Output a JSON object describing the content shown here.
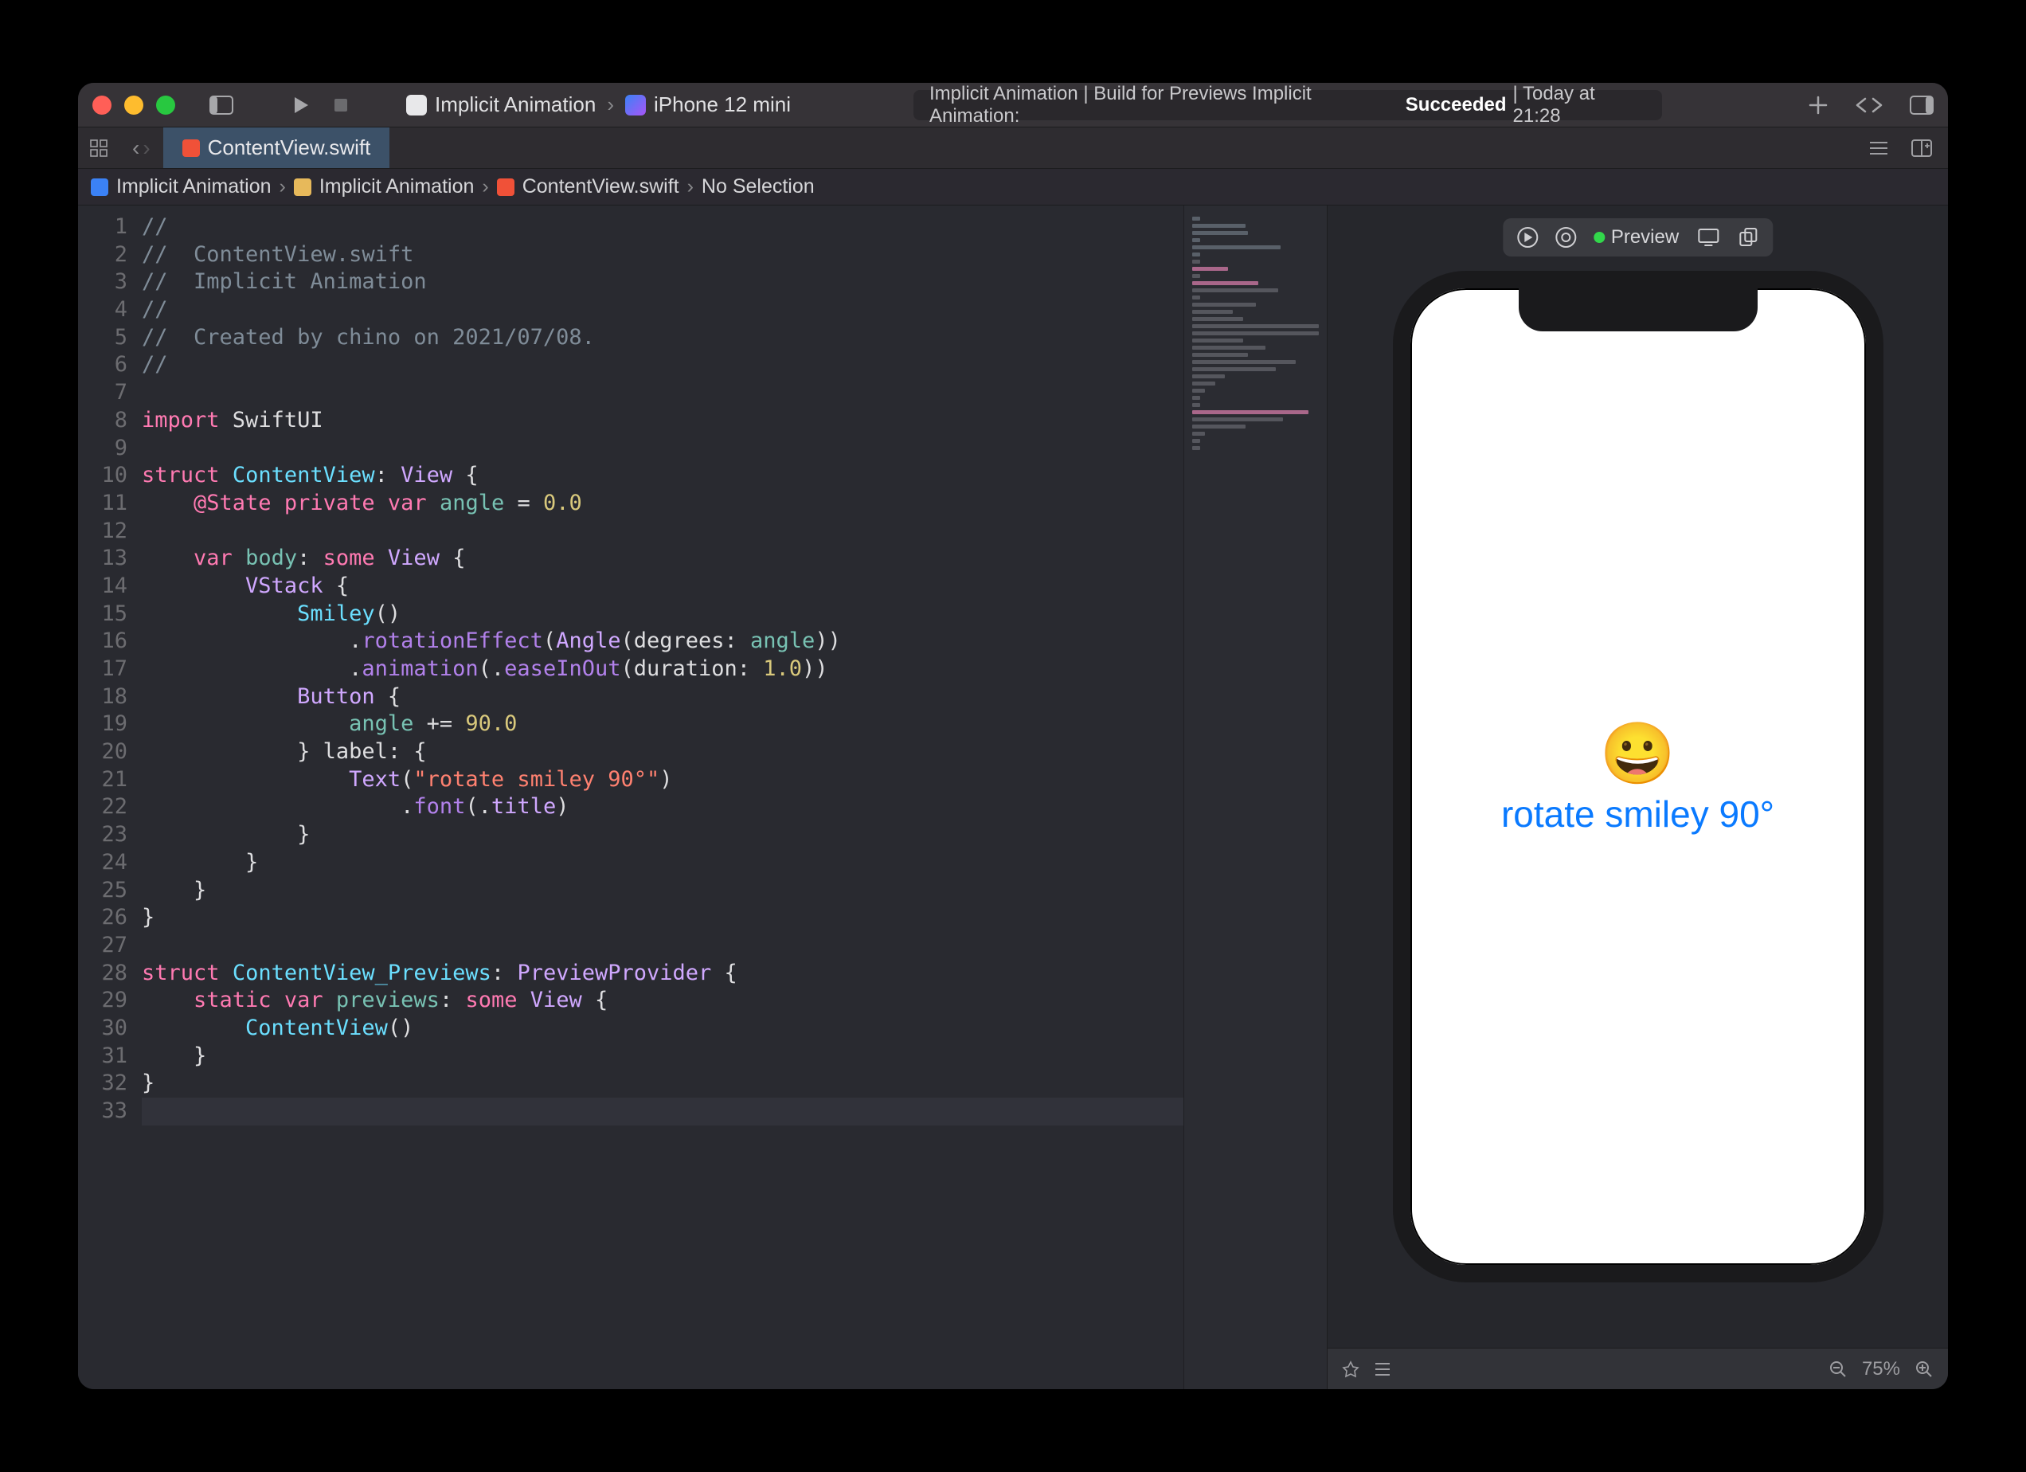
{
  "toolbar": {
    "scheme_project": "Implicit Animation",
    "scheme_device": "iPhone 12 mini"
  },
  "status": {
    "prefix": "Implicit Animation | Build for Previews Implicit Animation: ",
    "result": "Succeeded",
    "suffix": " | Today at 21:28"
  },
  "tab": {
    "filename": "ContentView.swift"
  },
  "jumpbar": {
    "project": "Implicit Animation",
    "group": "Implicit Animation",
    "file": "ContentView.swift",
    "selection": "No Selection"
  },
  "code": {
    "lines": [
      {
        "n": 1,
        "seg": [
          {
            "c": "cmt",
            "t": "//"
          }
        ]
      },
      {
        "n": 2,
        "seg": [
          {
            "c": "cmt",
            "t": "//  ContentView.swift"
          }
        ]
      },
      {
        "n": 3,
        "seg": [
          {
            "c": "cmt",
            "t": "//  Implicit Animation"
          }
        ]
      },
      {
        "n": 4,
        "seg": [
          {
            "c": "cmt",
            "t": "//"
          }
        ]
      },
      {
        "n": 5,
        "seg": [
          {
            "c": "cmt",
            "t": "//  Created by chino on 2021/07/08."
          }
        ]
      },
      {
        "n": 6,
        "seg": [
          {
            "c": "cmt",
            "t": "//"
          }
        ]
      },
      {
        "n": 7,
        "seg": []
      },
      {
        "n": 8,
        "seg": [
          {
            "c": "kw-pink",
            "t": "import"
          },
          {
            "c": "plain",
            "t": " SwiftUI"
          }
        ]
      },
      {
        "n": 9,
        "seg": []
      },
      {
        "n": 10,
        "seg": [
          {
            "c": "kw-pink",
            "t": "struct"
          },
          {
            "c": "plain",
            "t": " "
          },
          {
            "c": "type",
            "t": "ContentView"
          },
          {
            "c": "plain",
            "t": ": "
          },
          {
            "c": "type2",
            "t": "View"
          },
          {
            "c": "plain",
            "t": " {"
          }
        ]
      },
      {
        "n": 11,
        "seg": [
          {
            "c": "plain",
            "t": "    "
          },
          {
            "c": "kw-pink",
            "t": "@State"
          },
          {
            "c": "plain",
            "t": " "
          },
          {
            "c": "kw-pink",
            "t": "private"
          },
          {
            "c": "plain",
            "t": " "
          },
          {
            "c": "kw-pink",
            "t": "var"
          },
          {
            "c": "plain",
            "t": " "
          },
          {
            "c": "ident",
            "t": "angle"
          },
          {
            "c": "plain",
            "t": " = "
          },
          {
            "c": "num",
            "t": "0.0"
          }
        ]
      },
      {
        "n": 12,
        "seg": []
      },
      {
        "n": 13,
        "seg": [
          {
            "c": "plain",
            "t": "    "
          },
          {
            "c": "kw-pink",
            "t": "var"
          },
          {
            "c": "plain",
            "t": " "
          },
          {
            "c": "ident",
            "t": "body"
          },
          {
            "c": "plain",
            "t": ": "
          },
          {
            "c": "kw-pink",
            "t": "some"
          },
          {
            "c": "plain",
            "t": " "
          },
          {
            "c": "type2",
            "t": "View"
          },
          {
            "c": "plain",
            "t": " {"
          }
        ]
      },
      {
        "n": 14,
        "seg": [
          {
            "c": "plain",
            "t": "        "
          },
          {
            "c": "type2",
            "t": "VStack"
          },
          {
            "c": "plain",
            "t": " {"
          }
        ]
      },
      {
        "n": 15,
        "seg": [
          {
            "c": "plain",
            "t": "            "
          },
          {
            "c": "type",
            "t": "Smiley"
          },
          {
            "c": "plain",
            "t": "()"
          }
        ]
      },
      {
        "n": 16,
        "seg": [
          {
            "c": "plain",
            "t": "                ."
          },
          {
            "c": "method",
            "t": "rotationEffect"
          },
          {
            "c": "plain",
            "t": "("
          },
          {
            "c": "type2",
            "t": "Angle"
          },
          {
            "c": "plain",
            "t": "(degrees: "
          },
          {
            "c": "ident",
            "t": "angle"
          },
          {
            "c": "plain",
            "t": "))"
          }
        ]
      },
      {
        "n": 17,
        "seg": [
          {
            "c": "plain",
            "t": "                ."
          },
          {
            "c": "method",
            "t": "animation"
          },
          {
            "c": "plain",
            "t": "(."
          },
          {
            "c": "method",
            "t": "easeInOut"
          },
          {
            "c": "plain",
            "t": "(duration: "
          },
          {
            "c": "num",
            "t": "1.0"
          },
          {
            "c": "plain",
            "t": "))"
          }
        ]
      },
      {
        "n": 18,
        "seg": [
          {
            "c": "plain",
            "t": "            "
          },
          {
            "c": "type2",
            "t": "Button"
          },
          {
            "c": "plain",
            "t": " {"
          }
        ]
      },
      {
        "n": 19,
        "seg": [
          {
            "c": "plain",
            "t": "                "
          },
          {
            "c": "ident",
            "t": "angle"
          },
          {
            "c": "plain",
            "t": " += "
          },
          {
            "c": "num",
            "t": "90.0"
          }
        ]
      },
      {
        "n": 20,
        "seg": [
          {
            "c": "plain",
            "t": "            } label: {"
          }
        ]
      },
      {
        "n": 21,
        "seg": [
          {
            "c": "plain",
            "t": "                "
          },
          {
            "c": "type2",
            "t": "Text"
          },
          {
            "c": "plain",
            "t": "("
          },
          {
            "c": "str",
            "t": "\"rotate smiley 90°\""
          },
          {
            "c": "plain",
            "t": ")"
          }
        ]
      },
      {
        "n": 22,
        "seg": [
          {
            "c": "plain",
            "t": "                    ."
          },
          {
            "c": "method",
            "t": "font"
          },
          {
            "c": "plain",
            "t": "(."
          },
          {
            "c": "enum",
            "t": "title"
          },
          {
            "c": "plain",
            "t": ")"
          }
        ]
      },
      {
        "n": 23,
        "seg": [
          {
            "c": "plain",
            "t": "            }"
          }
        ]
      },
      {
        "n": 24,
        "seg": [
          {
            "c": "plain",
            "t": "        }"
          }
        ]
      },
      {
        "n": 25,
        "seg": [
          {
            "c": "plain",
            "t": "    }"
          }
        ]
      },
      {
        "n": 26,
        "seg": [
          {
            "c": "plain",
            "t": "}"
          }
        ]
      },
      {
        "n": 27,
        "seg": []
      },
      {
        "n": 28,
        "seg": [
          {
            "c": "kw-pink",
            "t": "struct"
          },
          {
            "c": "plain",
            "t": " "
          },
          {
            "c": "type",
            "t": "ContentView_Previews"
          },
          {
            "c": "plain",
            "t": ": "
          },
          {
            "c": "type2",
            "t": "PreviewProvider"
          },
          {
            "c": "plain",
            "t": " {"
          }
        ]
      },
      {
        "n": 29,
        "seg": [
          {
            "c": "plain",
            "t": "    "
          },
          {
            "c": "kw-pink",
            "t": "static"
          },
          {
            "c": "plain",
            "t": " "
          },
          {
            "c": "kw-pink",
            "t": "var"
          },
          {
            "c": "plain",
            "t": " "
          },
          {
            "c": "ident",
            "t": "previews"
          },
          {
            "c": "plain",
            "t": ": "
          },
          {
            "c": "kw-pink",
            "t": "some"
          },
          {
            "c": "plain",
            "t": " "
          },
          {
            "c": "type2",
            "t": "View"
          },
          {
            "c": "plain",
            "t": " {"
          }
        ]
      },
      {
        "n": 30,
        "seg": [
          {
            "c": "plain",
            "t": "        "
          },
          {
            "c": "type",
            "t": "ContentView"
          },
          {
            "c": "plain",
            "t": "()"
          }
        ]
      },
      {
        "n": 31,
        "seg": [
          {
            "c": "plain",
            "t": "    }"
          }
        ]
      },
      {
        "n": 32,
        "seg": [
          {
            "c": "plain",
            "t": "}"
          }
        ]
      },
      {
        "n": 33,
        "seg": [],
        "hl": true
      }
    ]
  },
  "preview": {
    "label": "Preview",
    "smiley": "😀",
    "button_text": "rotate smiley 90°",
    "zoom": "75%"
  }
}
